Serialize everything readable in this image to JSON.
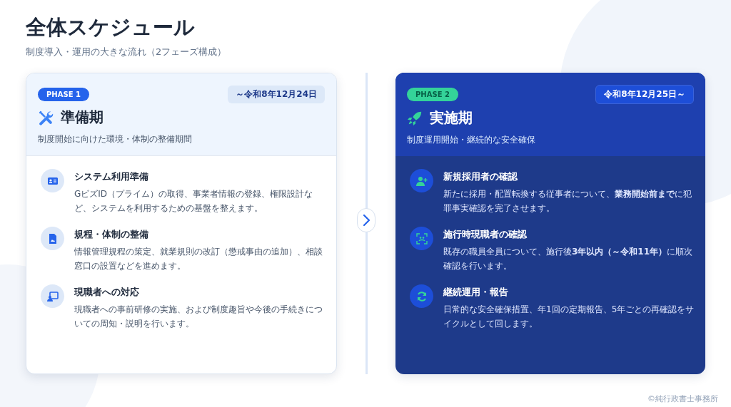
{
  "title": "全体スケジュール",
  "subtitle": "制度導入・運用の大きな流れ（2フェーズ構成）",
  "phases": [
    {
      "kind": "light",
      "badge": "PHASE 1",
      "period": "～令和8年12月24日",
      "name": "準備期",
      "description": "制度開始に向けた環境・体制の整備期間",
      "items": [
        {
          "title": "システム利用準備",
          "text": "GビズID（プライム）の取得、事業者情報の登録、権限設計など、システムを利用するための基盤を整えます。"
        },
        {
          "title": "規程・体制の整備",
          "text": "情報管理規程の策定、就業規則の改訂（懲戒事由の追加）、相談窓口の設置などを進めます。"
        },
        {
          "title": "現職者への対応",
          "text": "現職者への事前研修の実施、および制度趣旨や今後の手続きについての周知・説明を行います。"
        }
      ]
    },
    {
      "kind": "dark",
      "badge": "PHASE 2",
      "period": "令和8年12月25日～",
      "name": "実施期",
      "description": "制度運用開始・継続的な安全確保",
      "items": [
        {
          "title": "新規採用者の確認",
          "text": "新たに採用・配置転換する従事者について、**業務開始前まで**に犯罪事実確認を完了させます。"
        },
        {
          "title": "施行時現職者の確認",
          "text": "既存の職員全員について、施行後**3年以内（～令和11年）**に順次確認を行います。"
        },
        {
          "title": "継続運用・報告",
          "text": "日常的な安全確保措置、年1回の定期報告、5年ごとの再確認をサイクルとして回します。"
        }
      ]
    }
  ],
  "footer": "©純行政書士事務所"
}
